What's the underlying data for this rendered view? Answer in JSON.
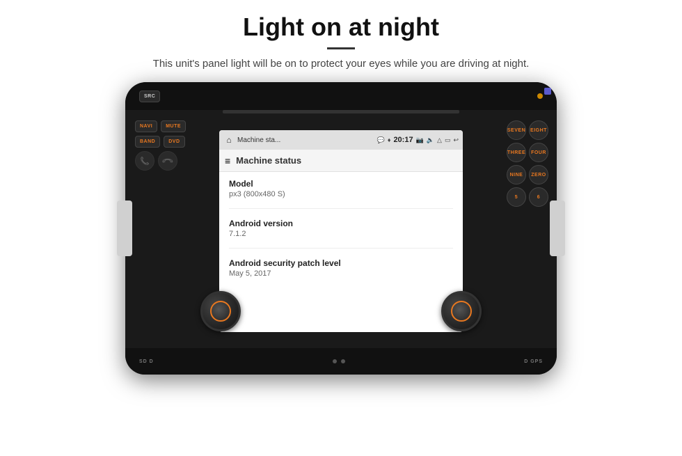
{
  "page": {
    "heading": "Light on at night",
    "subtitle": "This unit's panel light will be on to protect your eyes while you are driving at night.",
    "divider": true
  },
  "unit": {
    "topButtons": {
      "src": "SRC"
    },
    "leftPanel": {
      "row1": [
        "NAVI",
        "MUTE"
      ],
      "row2": [
        "BAND",
        "DVD"
      ],
      "phoneGreen": "☎",
      "phoneRed": "☎"
    },
    "rightPanel": {
      "row1": [
        "SEVEN",
        "EIGHT"
      ],
      "row2": [
        "THREE",
        "FOUR"
      ],
      "row3": [
        "NINE",
        "ZERO"
      ],
      "row4": [
        "5",
        "6"
      ]
    }
  },
  "android": {
    "statusBar": {
      "appName": "Machine sta...",
      "time": "20:17",
      "icons": [
        "💬",
        "♦",
        "📷",
        "🔈",
        "△",
        "▭",
        "↩"
      ]
    },
    "actionBar": {
      "title": "Machine status",
      "menuIcon": "≡"
    },
    "info": [
      {
        "title": "Model",
        "value": "px3 (800x480 S)"
      },
      {
        "title": "Android version",
        "value": "7.1.2"
      },
      {
        "title": "Android security patch level",
        "value": "May 5, 2017"
      }
    ]
  },
  "bottom": {
    "leftLabel": "SD  D",
    "rightLabel": "D  GPS"
  }
}
